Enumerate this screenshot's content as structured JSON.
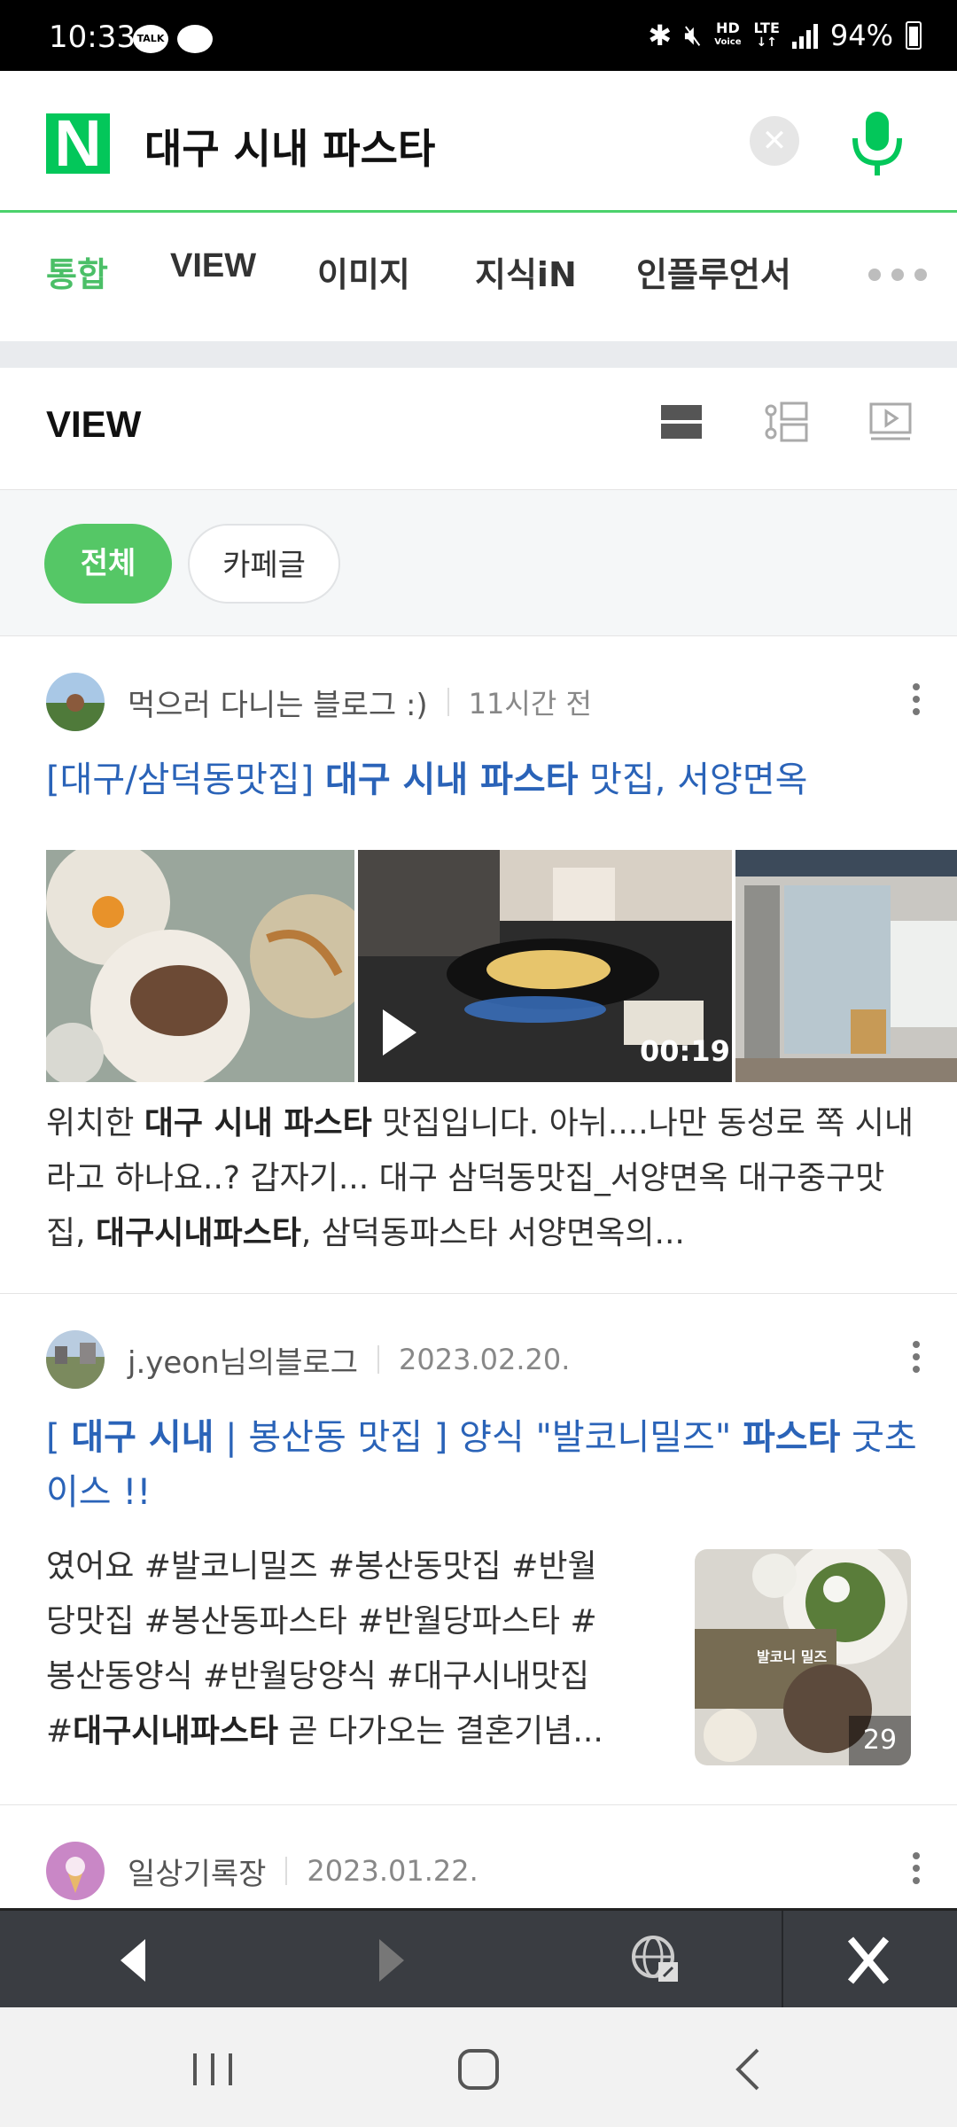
{
  "status_bar": {
    "time": "10:33",
    "talk_label": "TALK",
    "hd_label": "HD",
    "voice_label": "Voice",
    "lte_label": "LTE",
    "battery": "94%"
  },
  "search": {
    "logo": "N",
    "query": "대구 시내 파스타",
    "clear_icon": "close-icon",
    "mic_icon": "mic-icon"
  },
  "tabs": [
    {
      "label": "통합",
      "active": true
    },
    {
      "label": "VIEW",
      "active": false
    },
    {
      "label": "이미지",
      "active": false
    },
    {
      "label": "지식iN",
      "active": false
    },
    {
      "label": "인플루언서",
      "active": false
    }
  ],
  "view_section": {
    "title": "VIEW",
    "filters": [
      "전체",
      "카페글"
    ]
  },
  "posts": [
    {
      "author": "먹으러 다니는 블로그 :)",
      "date": "11시간 전",
      "title_parts": [
        "[대구/삼덕동맛집] ",
        "대구 시내 파스타",
        " 맛집, 서양면옥"
      ],
      "video_duration": "00:19",
      "desc_parts": [
        "위치한 ",
        "대구 시내 파스타",
        " 맛집입니다. 아뉘....나만 동성로 쪽 시내라고 하나요..? 갑자기... 대구 삼덕동맛집_서양면옥 대구중구맛집, ",
        "대구시내파스타",
        ", 삼덕동파스타 서양면옥의..."
      ]
    },
    {
      "author": "j.yeon님의블로그",
      "date": "2023.02.20.",
      "title_parts": [
        "[ ",
        "대구 시내",
        " | 봉산동 맛집 ] 양식 \"발코니밀즈\" ",
        "파스타",
        " 굿초이스 !!"
      ],
      "desc_lines": [
        "였어요 #발코니밀즈 #봉산동맛집 #반월",
        "당맛집 #봉산동파스타 #반월당파스타 #",
        "봉산동양식 #반월당양식 #대구시내맛집"
      ],
      "desc_last_parts": [
        "#",
        "대구시내파스타",
        " 곧 다가오는 결혼기념..."
      ],
      "thumb_overlay": "발코니 밀즈",
      "thumb_count": "29"
    },
    {
      "author": "일상기록장",
      "date": "2023.01.22."
    }
  ],
  "colors": {
    "accent_green": "#03c75a",
    "link_blue": "#2a63b8"
  }
}
